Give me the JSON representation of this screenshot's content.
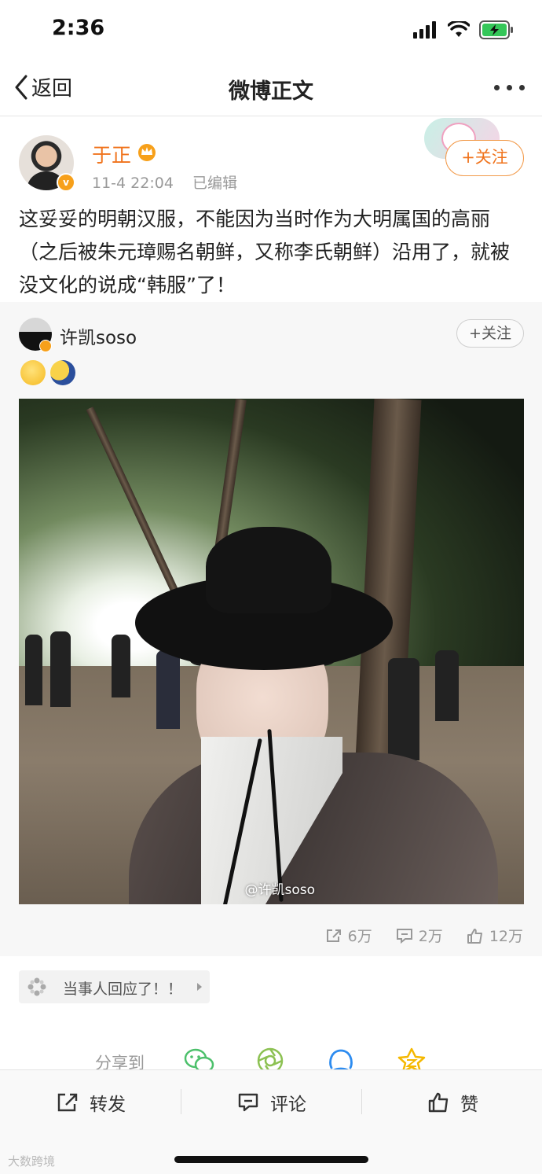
{
  "status_bar": {
    "time": "2:36",
    "colors": {
      "battery": "#34c759"
    }
  },
  "nav": {
    "back_label": "返回",
    "title": "微博正文"
  },
  "post": {
    "author": "于正",
    "time": "11-4 22:04",
    "edited": "已编辑",
    "follow_label": "+关注",
    "text": "这妥妥的明朝汉服，不能因为当时作为大明属国的高丽（之后被朱元璋赐名朝鲜，又称李氏朝鲜）沿用了，就被没文化的说成“韩服”了！"
  },
  "repost": {
    "author": "许凯soso",
    "follow_label": "+关注",
    "emojis": [
      "thinking-emoji",
      "moon-emoji"
    ],
    "watermark": "@许凯soso",
    "stats": {
      "reposts": "6万",
      "comments": "2万",
      "likes": "12万"
    }
  },
  "topic": {
    "label": "当事人回应了！！"
  },
  "share": {
    "label": "分享到",
    "targets": [
      "wechat-icon",
      "moments-icon",
      "qq-icon",
      "qzone-icon"
    ]
  },
  "actions": {
    "repost": "转发",
    "comment": "评论",
    "like": "赞"
  },
  "corner_mark": "大数跨境",
  "colors": {
    "accent": "#f0731c",
    "vip": "#f7a01a",
    "secondary_text": "#999999"
  }
}
